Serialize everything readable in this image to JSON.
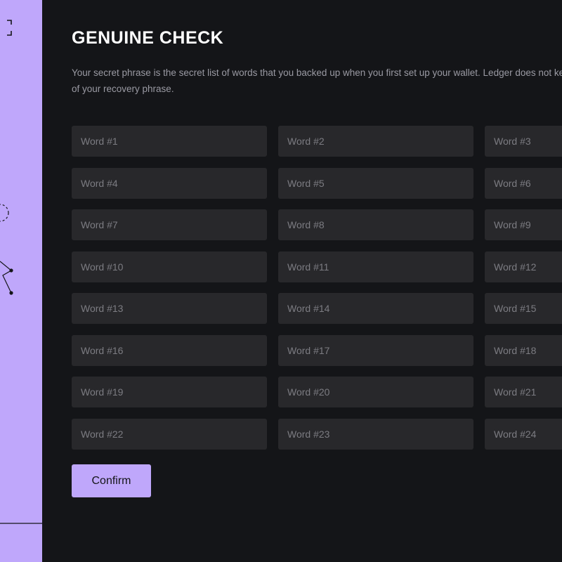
{
  "colors": {
    "accent": "#bfa7fb",
    "background": "#141518",
    "input_background": "#28282b"
  },
  "header": {
    "title": "GENUINE CHECK"
  },
  "description": "Your secret phrase is the secret list of words that you backed up when you first set up your wallet. Ledger does not keep a copy of your recovery phrase.",
  "word_fields": [
    {
      "placeholder": "Word #1",
      "value": ""
    },
    {
      "placeholder": "Word #2",
      "value": ""
    },
    {
      "placeholder": "Word #3",
      "value": ""
    },
    {
      "placeholder": "Word #4",
      "value": ""
    },
    {
      "placeholder": "Word #5",
      "value": ""
    },
    {
      "placeholder": "Word #6",
      "value": ""
    },
    {
      "placeholder": "Word #7",
      "value": ""
    },
    {
      "placeholder": "Word #8",
      "value": ""
    },
    {
      "placeholder": "Word #9",
      "value": ""
    },
    {
      "placeholder": "Word #10",
      "value": ""
    },
    {
      "placeholder": "Word #11",
      "value": ""
    },
    {
      "placeholder": "Word #12",
      "value": ""
    },
    {
      "placeholder": "Word #13",
      "value": ""
    },
    {
      "placeholder": "Word #14",
      "value": ""
    },
    {
      "placeholder": "Word #15",
      "value": ""
    },
    {
      "placeholder": "Word #16",
      "value": ""
    },
    {
      "placeholder": "Word #17",
      "value": ""
    },
    {
      "placeholder": "Word #18",
      "value": ""
    },
    {
      "placeholder": "Word #19",
      "value": ""
    },
    {
      "placeholder": "Word #20",
      "value": ""
    },
    {
      "placeholder": "Word #21",
      "value": ""
    },
    {
      "placeholder": "Word #22",
      "value": ""
    },
    {
      "placeholder": "Word #23",
      "value": ""
    },
    {
      "placeholder": "Word #24",
      "value": ""
    }
  ],
  "actions": {
    "confirm_label": "Confirm"
  },
  "side_panel": {
    "decorations": [
      "corner-bracket-icon",
      "dashed-circle-icon",
      "zigzag-line-icon"
    ]
  }
}
